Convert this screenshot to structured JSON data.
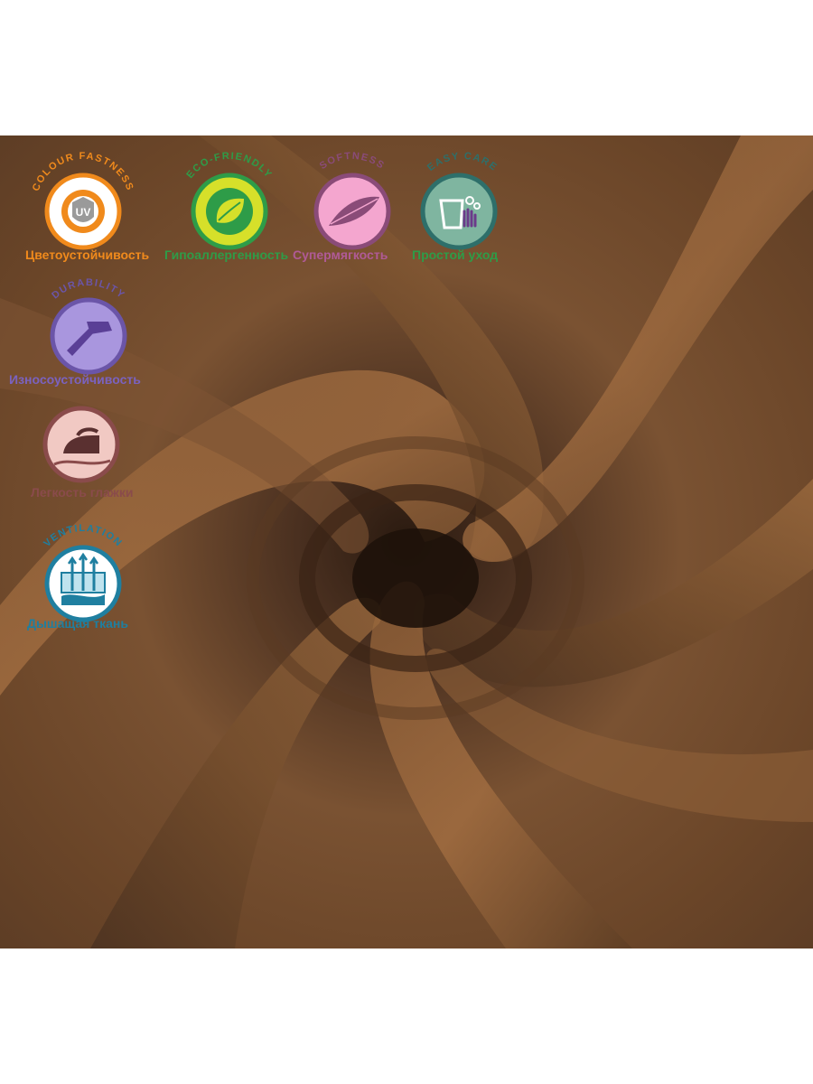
{
  "badges": [
    {
      "arc_text": "COLOUR FASTNESS",
      "label": "Цветоустойчивость",
      "icon": "uv-sun-icon",
      "icon_text": "UV",
      "ring_color": "#f08a1c",
      "fill_color": "#ffffff",
      "label_color": "#f08a1c"
    },
    {
      "arc_text": "ECO-FRIENDLY",
      "label": "Гипоаллергенность",
      "icon": "leaf-icon",
      "ring_color": "#2e9c48",
      "fill_color": "#d6e02a",
      "label_color": "#2e9c48"
    },
    {
      "arc_text": "SOFTNESS",
      "label": "Супермягкость",
      "icon": "feather-icon",
      "ring_color": "#8a4b78",
      "fill_color": "#f4a6cf",
      "label_color": "#b05a96"
    },
    {
      "arc_text": "EASY CARE",
      "label": "Простой уход",
      "icon": "easy-care-hand-icon",
      "ring_color": "#2e6f6a",
      "fill_color": "#7fb5a0",
      "label_color": "#2e9c48"
    },
    {
      "arc_text": "DURABILITY",
      "label": "Износоустойчивость",
      "icon": "hammer-icon",
      "ring_color": "#6b55a8",
      "fill_color": "#a996de",
      "label_color": "#7a62c0"
    },
    {
      "arc_text": "",
      "label": "Легкость глажки",
      "icon": "iron-icon",
      "ring_color": "#8a4b4b",
      "fill_color": "#f1c9c3",
      "label_color": "#8a4b4b"
    },
    {
      "arc_text": "VENTILATION",
      "label": "Дышащая ткань",
      "icon": "breathable-fabric-icon",
      "ring_color": "#1f7fa0",
      "fill_color": "#ffffff",
      "label_color": "#1f7fa0"
    }
  ],
  "colors": {
    "fabric_base": "#6e4a2e",
    "fabric_dark": "#2a1a10",
    "fabric_light": "#9a6a40"
  }
}
